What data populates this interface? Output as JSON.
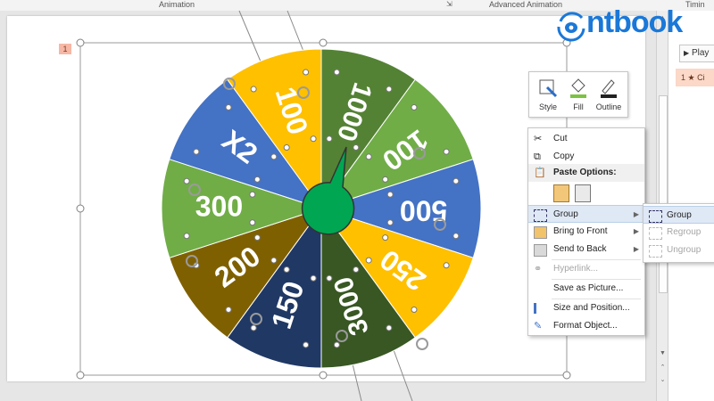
{
  "ribbon": {
    "animation_label": "Animation",
    "advanced_animation_label": "Advanced Animation",
    "timing_label": "Timin"
  },
  "logo": {
    "text": "ntbook"
  },
  "slide": {
    "number": "1"
  },
  "wheel": {
    "segments": [
      {
        "label": "1000",
        "color": "#548235"
      },
      {
        "label": "100",
        "color": "#70ad47"
      },
      {
        "label": "500",
        "color": "#4472c4"
      },
      {
        "label": "250",
        "color": "#ffc000"
      },
      {
        "label": "3000",
        "color": "#385723"
      },
      {
        "label": "150",
        "color": "#203864"
      },
      {
        "label": "200",
        "color": "#7f6000"
      },
      {
        "label": "300",
        "color": "#70ad47"
      },
      {
        "label": "X2",
        "color": "#4472c4"
      },
      {
        "label": "100",
        "color": "#ffc000"
      }
    ],
    "pointer_color": "#00a651"
  },
  "minitoolbar": {
    "style": {
      "label": "Style",
      "icon": "style-icon"
    },
    "fill": {
      "label": "Fill",
      "icon": "fill-bucket-icon"
    },
    "outline": {
      "label": "Outline",
      "icon": "outline-pen-icon"
    }
  },
  "context_menu": {
    "items": [
      {
        "label": "Cut",
        "icon": "scissors-icon",
        "enabled": true
      },
      {
        "label": "Copy",
        "icon": "copy-icon",
        "enabled": true
      },
      {
        "label": "Paste Options:",
        "icon": "paste-icon",
        "enabled": true
      },
      {
        "label": "Group",
        "icon": "group-icon",
        "enabled": true,
        "submenu": true
      },
      {
        "label": "Bring to Front",
        "icon": "bring-front-icon",
        "enabled": true,
        "submenu": true
      },
      {
        "label": "Send to Back",
        "icon": "send-back-icon",
        "enabled": true,
        "submenu": true
      },
      {
        "label": "Hyperlink...",
        "icon": "link-icon",
        "enabled": false
      },
      {
        "label": "Save as Picture...",
        "icon": "",
        "enabled": true
      },
      {
        "label": "Size and Position...",
        "icon": "size-position-icon",
        "enabled": true
      },
      {
        "label": "Format Object...",
        "icon": "format-icon",
        "enabled": true
      }
    ]
  },
  "group_submenu": {
    "items": [
      {
        "label": "Group",
        "enabled": true
      },
      {
        "label": "Regroup",
        "enabled": false
      },
      {
        "label": "Ungroup",
        "enabled": false
      }
    ]
  },
  "animation_pane": {
    "play_label": "Play",
    "item_label": "1 ★ Ci"
  }
}
